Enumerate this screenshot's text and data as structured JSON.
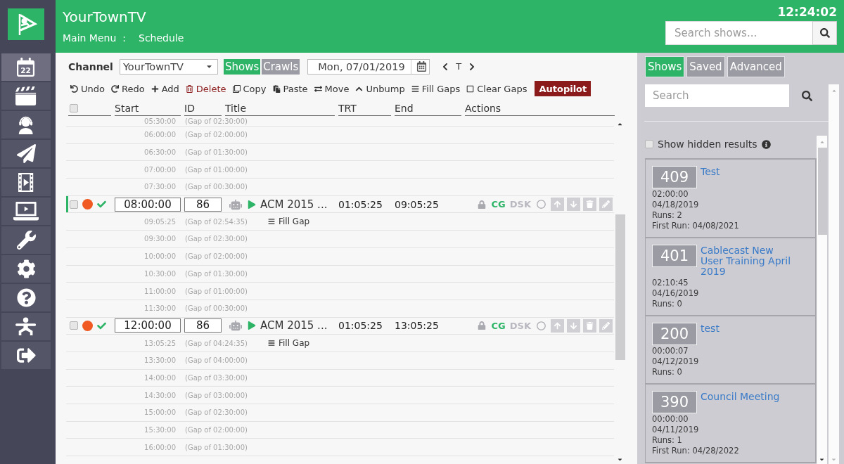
{
  "header": {
    "title": "YourTownTV",
    "breadcrumb": [
      "Main Menu",
      "Schedule"
    ],
    "separator": ":",
    "clock": "12:24:02",
    "search": {
      "placeholder": "Search shows..."
    }
  },
  "sidebar": {
    "items": [
      {
        "kind": "calendar",
        "text": "22",
        "selected": true
      },
      {
        "kind": "clapperboard",
        "selected": false
      },
      {
        "kind": "headset",
        "selected": false
      },
      {
        "kind": "plane",
        "selected": false
      },
      {
        "kind": "film",
        "selected": false
      },
      {
        "kind": "laptop",
        "selected": false
      },
      {
        "kind": "wrench",
        "selected": false
      },
      {
        "kind": "gear",
        "selected": false
      },
      {
        "kind": "help",
        "selected": false
      },
      {
        "kind": "figure",
        "selected": false
      },
      {
        "kind": "signout",
        "selected": false
      }
    ]
  },
  "channel_bar": {
    "label": "Channel",
    "channel": "YourTownTV",
    "views": [
      {
        "label": "Shows",
        "selected": true
      },
      {
        "label": "Crawls",
        "selected": false
      }
    ],
    "date": "Mon, 07/01/2019",
    "today": "T"
  },
  "actions": [
    {
      "kind": "undo",
      "label": "Undo",
      "danger": false
    },
    {
      "kind": "redo",
      "label": "Redo",
      "danger": false
    },
    {
      "kind": "add",
      "label": "Add",
      "danger": false
    },
    {
      "kind": "delete",
      "label": "Delete",
      "danger": true
    },
    {
      "kind": "copy",
      "label": "Copy",
      "danger": false
    },
    {
      "kind": "paste",
      "label": "Paste",
      "danger": false
    },
    {
      "kind": "move",
      "label": "Move",
      "danger": false
    },
    {
      "kind": "unbump",
      "label": "Unbump",
      "danger": false
    },
    {
      "kind": "fill",
      "label": "Fill Gaps",
      "danger": false
    },
    {
      "kind": "clear",
      "label": "Clear Gaps",
      "danger": false
    }
  ],
  "autopilot": "Autopilot",
  "table": {
    "select_all": {
      "checked": false
    },
    "columns": [
      "Start",
      "ID",
      "Title",
      "TRT",
      "End",
      "Actions"
    ],
    "rows": [
      {
        "kind": "gap",
        "time": "05:30:00",
        "gap": "(Gap of 02:30:00)"
      },
      {
        "kind": "gap",
        "time": "06:00:00",
        "gap": "(Gap of 02:00:00)"
      },
      {
        "kind": "gap",
        "time": "06:30:00",
        "gap": "(Gap of 01:30:00)"
      },
      {
        "kind": "gap",
        "time": "07:00:00",
        "gap": "(Gap of 01:00:00)"
      },
      {
        "kind": "gap",
        "time": "07:30:00",
        "gap": "(Gap of 00:30:00)"
      },
      {
        "kind": "show",
        "checked": false,
        "current": true,
        "start": "08:00:00",
        "id": "86",
        "title": "ACM 2015 ...",
        "trt": "01:05:25",
        "end": "09:05:25",
        "overlays": [
          {
            "label": "CG",
            "on": true
          },
          {
            "label": "DSK",
            "on": false
          }
        ]
      },
      {
        "kind": "gap",
        "time": "09:05:25",
        "gap": "(Gap of 02:54:35)",
        "action": "Fill Gap"
      },
      {
        "kind": "gap",
        "time": "09:30:00",
        "gap": "(Gap of 02:30:00)"
      },
      {
        "kind": "gap",
        "time": "10:00:00",
        "gap": "(Gap of 02:00:00)"
      },
      {
        "kind": "gap",
        "time": "10:30:00",
        "gap": "(Gap of 01:30:00)"
      },
      {
        "kind": "gap",
        "time": "11:00:00",
        "gap": "(Gap of 01:00:00)"
      },
      {
        "kind": "gap",
        "time": "11:30:00",
        "gap": "(Gap of 00:30:00)"
      },
      {
        "kind": "show",
        "checked": false,
        "current": false,
        "start": "12:00:00",
        "id": "86",
        "title": "ACM 2015 ...",
        "trt": "01:05:25",
        "end": "13:05:25",
        "overlays": [
          {
            "label": "CG",
            "on": true
          },
          {
            "label": "DSK",
            "on": false
          }
        ]
      },
      {
        "kind": "gap",
        "time": "13:05:25",
        "gap": "(Gap of 04:24:35)",
        "action": "Fill Gap"
      },
      {
        "kind": "gap",
        "time": "13:30:00",
        "gap": "(Gap of 04:00:00)"
      },
      {
        "kind": "gap",
        "time": "14:00:00",
        "gap": "(Gap of 03:30:00)"
      },
      {
        "kind": "gap",
        "time": "14:30:00",
        "gap": "(Gap of 03:00:00)"
      },
      {
        "kind": "gap",
        "time": "15:00:00",
        "gap": "(Gap of 02:30:00)"
      },
      {
        "kind": "gap",
        "time": "15:30:00",
        "gap": "(Gap of 02:00:00)"
      },
      {
        "kind": "gap",
        "time": "16:00:00",
        "gap": "(Gap of 01:30:00)"
      }
    ]
  },
  "panel": {
    "tabs": [
      {
        "label": "Shows",
        "selected": true
      },
      {
        "label": "Saved",
        "selected": false
      },
      {
        "label": "Advanced",
        "selected": false
      }
    ],
    "search": {
      "placeholder": "Search"
    },
    "show_hidden": {
      "label": "Show hidden results",
      "checked": false
    },
    "results": [
      {
        "id": "409",
        "title": "Test",
        "details": [
          "02:00:00",
          "04/18/2019",
          "Runs: 2",
          "First Run: 04/08/2021"
        ]
      },
      {
        "id": "401",
        "title": "Cablecast New User Training April 2019",
        "details": [
          "02:10:45",
          "04/16/2019",
          "Runs: 0"
        ]
      },
      {
        "id": "200",
        "title": "test",
        "details": [
          "00:00:07",
          "04/12/2019",
          "Runs: 0"
        ]
      },
      {
        "id": "390",
        "title": "Council Meeting",
        "details": [
          "00:00:00",
          "04/11/2019",
          "Runs: 1",
          "First Run: 04/28/2022"
        ]
      }
    ]
  }
}
